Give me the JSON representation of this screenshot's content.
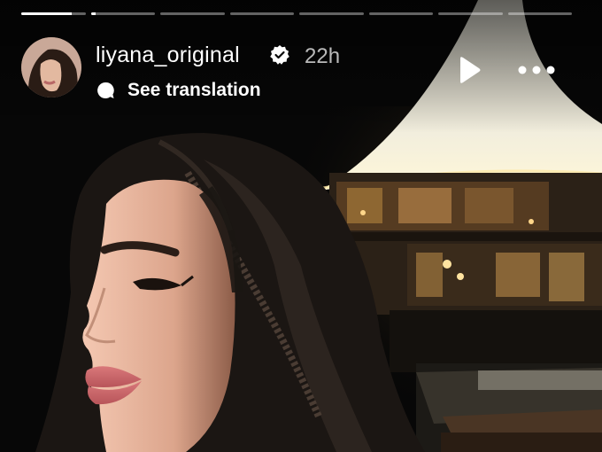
{
  "story": {
    "progress_segments": [
      0.78,
      0.07,
      0,
      0,
      0,
      0,
      0,
      0
    ],
    "username": "liyana_original",
    "verified": true,
    "timestamp": "22h",
    "translation_label": "See translation"
  },
  "icons": {
    "verified": "verified-badge-icon",
    "translation": "speech-bubble-icon",
    "play": "play-icon",
    "more": "more-options-icon"
  },
  "colors": {
    "background": "#050505",
    "text": "#ffffff",
    "timestamp": "#b8b8b8",
    "progress_track": "#5e5e5e",
    "progress_fill": "#ffffff"
  }
}
